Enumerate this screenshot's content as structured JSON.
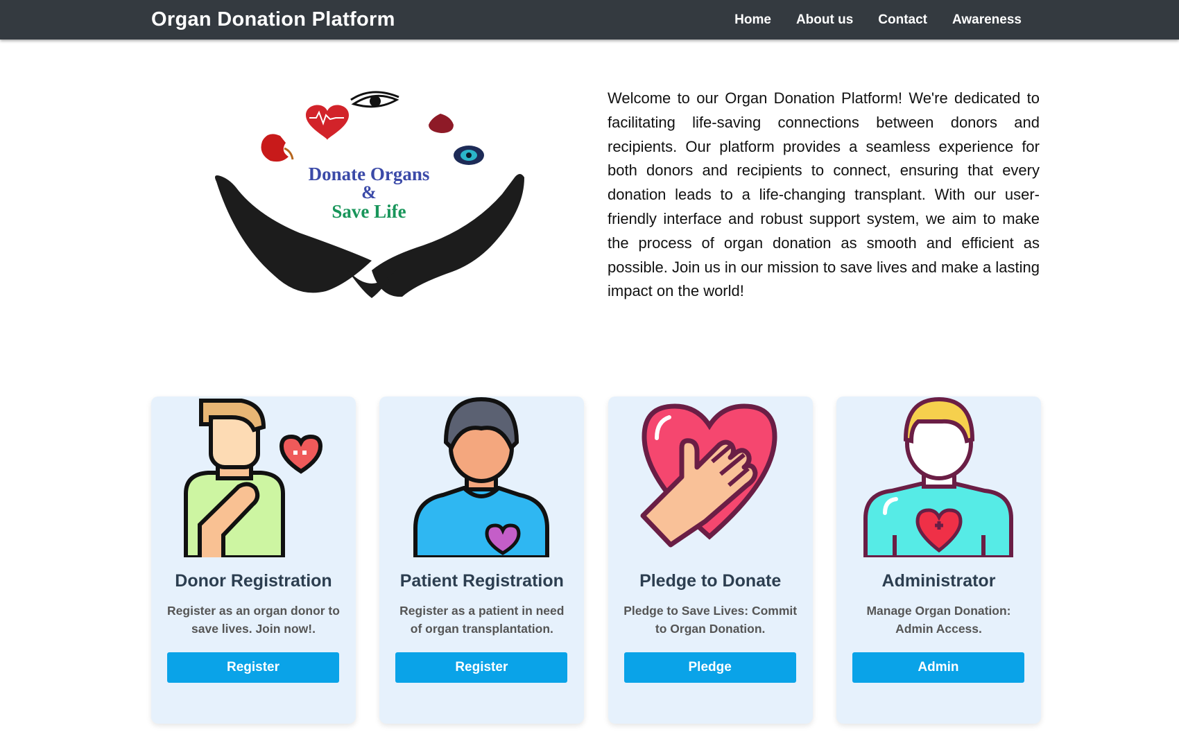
{
  "navbar": {
    "brand": "Organ Donation Platform",
    "links": [
      "Home",
      "About us",
      "Contact",
      "Awareness"
    ]
  },
  "hero": {
    "logo_text": {
      "line1": "Donate Organs",
      "line2": "&",
      "line3": "Save Life"
    },
    "intro": "Welcome to our Organ Donation Platform! We're dedicated to facilitating life-saving connections between donors and recipients. Our platform provides a seamless experience for both donors and recipients to connect, ensuring that every donation leads to a life-changing transplant. With our user-friendly interface and robust support system, we aim to make the process of organ donation as smooth and efficient as possible. Join us in our mission to save lives and make a lasting impact on the world!"
  },
  "cards": [
    {
      "icon": "donor-icon",
      "title": "Donor Registration",
      "desc": "Register as an organ donor to save lives. Join now!.",
      "button": "Register"
    },
    {
      "icon": "patient-icon",
      "title": "Patient Registration",
      "desc": "Register as a patient in need of organ transplantation.",
      "button": "Register"
    },
    {
      "icon": "heart-hand-icon",
      "title": "Pledge to Donate",
      "desc": "Pledge to Save Lives: Commit to Organ Donation.",
      "button": "Pledge"
    },
    {
      "icon": "administrator-icon",
      "title": "Administrator",
      "desc": "Manage Organ Donation: Admin Access.",
      "button": "Admin"
    }
  ],
  "colors": {
    "navbar": "#343a40",
    "card_background": "#e6f1fc",
    "button": "#0aa3e8",
    "card_title": "#2c3e50"
  }
}
